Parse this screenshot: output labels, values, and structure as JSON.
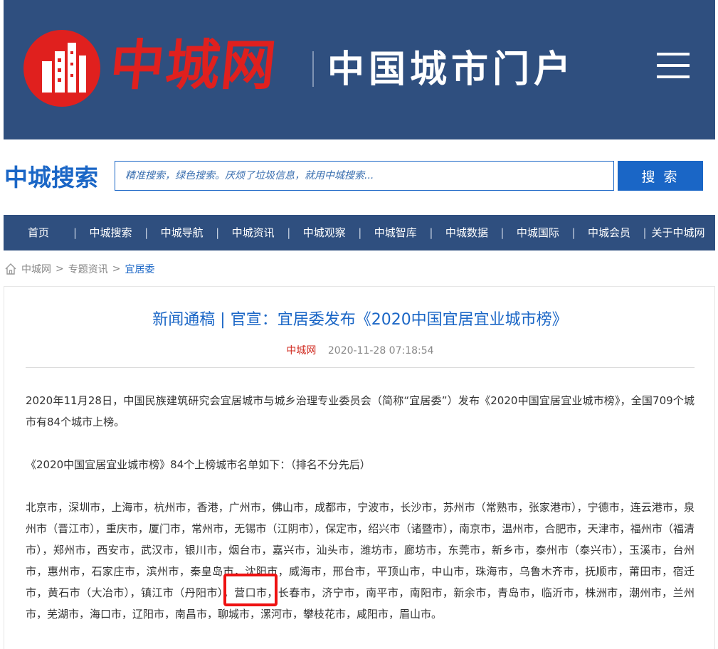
{
  "header": {
    "logo_text": "中城网",
    "title": "中国城市门户",
    "menu_icon": "hamburger-menu-icon"
  },
  "search": {
    "brand": "中城搜索",
    "placeholder": "精准搜索，绿色搜索。厌烦了垃圾信息，就用中城搜索...",
    "button_label": "搜 索"
  },
  "nav": {
    "items": [
      {
        "label": "首页"
      },
      {
        "label": "中城搜索"
      },
      {
        "label": "中城导航"
      },
      {
        "label": "中城资讯"
      },
      {
        "label": "中城观察"
      },
      {
        "label": "中城智库"
      },
      {
        "label": "中城数据"
      },
      {
        "label": "中城国际"
      },
      {
        "label": "中城会员"
      },
      {
        "label": "关于中城网"
      }
    ],
    "separator": "|"
  },
  "breadcrumb": {
    "home_icon": "home-icon",
    "items": [
      "中城网",
      "专题资讯",
      "宜居委"
    ],
    "separator": ">"
  },
  "article": {
    "title": "新闻通稿 | 官宣：宜居委发布《2020中国宜居宜业城市榜》",
    "source": "中城网",
    "date": "2020-11-28 07:18:54",
    "paragraphs": [
      "2020年11月28日，中国民族建筑研究会宜居城市与城乡治理专业委员会（简称“宜居委”）发布《2020中国宜居宜业城市榜》，全国709个城市有84个城市上榜。",
      "《2020中国宜居宜业城市榜》84个上榜城市名单如下：（排名不分先后）",
      "北京市，深圳市，上海市，杭州市，香港，广州市，佛山市，成都市，宁波市，长沙市，苏州市（常熟市，张家港市），宁德市，连云港市，泉州市（晋江市），重庆市，厦门市，常州市，无锡市（江阴市），保定市，绍兴市（诸暨市），南京市，温州市，合肥市，天津市，福州市（福清市），郑州市，西安市，武汉市，银川市，烟台市，嘉兴市，汕头市，潍坊市，廊坊市，东莞市，新乡市，泰州市（泰兴市），玉溪市，台州市，惠州市，石家庄市，滨州市，秦皇岛市，沈阳市，威海市，邢台市，平顶山市，中山市，珠海市，乌鲁木齐市，抚顺市，莆田市，宿迁市，黄石市（大冶市），镇江市（丹阳市），营口市，长春市，济宁市，南平市，南阳市，新余市，青岛市，临沂市，株洲市，潮州市，兰州市，芜湖市，海口市，辽阳市，南昌市，聊城市，漯河市，攀枝花市，咸阳市，眉山市。"
    ]
  },
  "colors": {
    "header_bg": "#2f4f7f",
    "brand_red": "#e0201e",
    "link_blue": "#1a66c6",
    "highlight_red": "#ee1111"
  }
}
